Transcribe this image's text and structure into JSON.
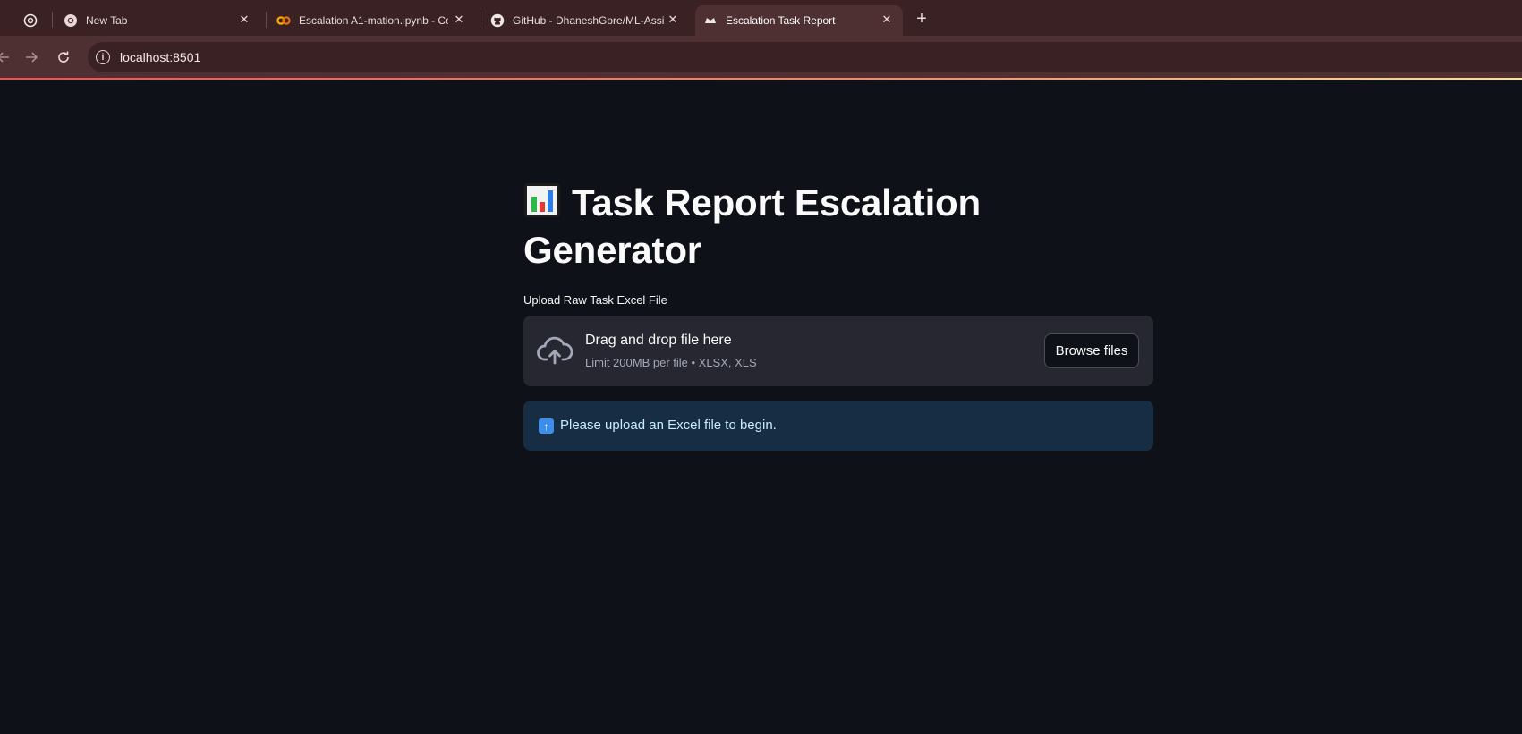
{
  "browser": {
    "tabs": [
      {
        "label": "",
        "icon": "openai-icon"
      },
      {
        "label": "New Tab",
        "icon": "chrome-icon"
      },
      {
        "label": "Escalation A1-mation.ipynb - Co",
        "icon": "colab-icon"
      },
      {
        "label": "GitHub - DhaneshGore/ML-Assi",
        "icon": "github-icon"
      },
      {
        "label": "Escalation Task Report",
        "icon": "streamlit-icon",
        "active": true
      }
    ],
    "url": "localhost:8501"
  },
  "app": {
    "title_line1": "Task Report Escalation",
    "title_line2": "Generator",
    "title_emoji": "bar-chart-icon",
    "uploader": {
      "label": "Upload Raw Task Excel File",
      "drag_text": "Drag and drop file here",
      "limit_text": "Limit 200MB per file • XLSX, XLS",
      "browse_label": "Browse files"
    },
    "info_message": "Please upload an Excel file to begin.",
    "info_icon": "up-arrow-icon"
  },
  "colors": {
    "background": "#0e1117",
    "dropzone": "#262730",
    "info_bg": "#172d43",
    "info_text": "#c7ebff",
    "tabbar": "#3a2224",
    "toolbar": "#4e2f32"
  }
}
